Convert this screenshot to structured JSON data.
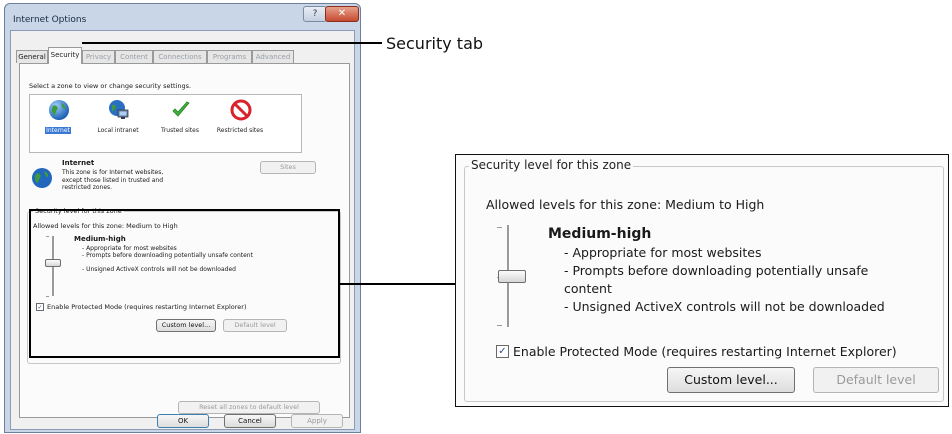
{
  "window": {
    "title": "Internet Options",
    "help_glyph": "?",
    "close_glyph": "✕"
  },
  "tabs": [
    {
      "label": "General"
    },
    {
      "label": "Security"
    },
    {
      "label": "Privacy"
    },
    {
      "label": "Content"
    },
    {
      "label": "Connections"
    },
    {
      "label": "Programs"
    },
    {
      "label": "Advanced"
    }
  ],
  "zones": {
    "prompt": "Select a zone to view or change security settings.",
    "items": [
      {
        "name": "Internet",
        "icon": "globe-icon"
      },
      {
        "name": "Local intranet",
        "icon": "intranet-icon"
      },
      {
        "name": "Trusted sites",
        "icon": "checkmark-icon"
      },
      {
        "name": "Restricted sites",
        "icon": "no-entry-icon"
      }
    ],
    "selected_title": "Internet",
    "selected_desc": "This zone is for Internet websites, except those listed in trusted and restricted zones.",
    "sites_button": "Sites"
  },
  "security_level": {
    "group_label": "Security level for this zone",
    "allowed": "Allowed levels for this zone: Medium to High",
    "level_name": "Medium-high",
    "bullets": [
      "- Appropriate for most websites",
      "- Prompts before downloading potentially unsafe content",
      "- Unsigned ActiveX controls will not be downloaded"
    ],
    "protected_mode_label": "Enable Protected Mode (requires restarting Internet Explorer)",
    "protected_mode_checked": true,
    "custom_level_button": "Custom level...",
    "default_level_button": "Default level",
    "reset_button": "Reset all zones to default level"
  },
  "dialog_buttons": {
    "ok": "OK",
    "cancel": "Cancel",
    "apply": "Apply"
  },
  "callouts": {
    "security_tab": "Security tab"
  },
  "zoom": {
    "group_label": "Security level for this zone",
    "allowed": "Allowed levels for this zone: Medium to High",
    "level_name": "Medium-high",
    "bullet_1": "- Appropriate for most websites",
    "bullet_2a": "- Prompts before downloading potentially unsafe",
    "bullet_2b": "content",
    "bullet_3": "- Unsigned ActiveX controls will not be downloaded",
    "protected_mode_label": "Enable Protected Mode (requires restarting Internet Explorer)",
    "custom_level_button": "Custom level...",
    "default_level_button": "Default level"
  },
  "colors": {
    "selection": "#3a78d6",
    "titlebar": "#c9d6e8",
    "close": "#c64a2f"
  }
}
